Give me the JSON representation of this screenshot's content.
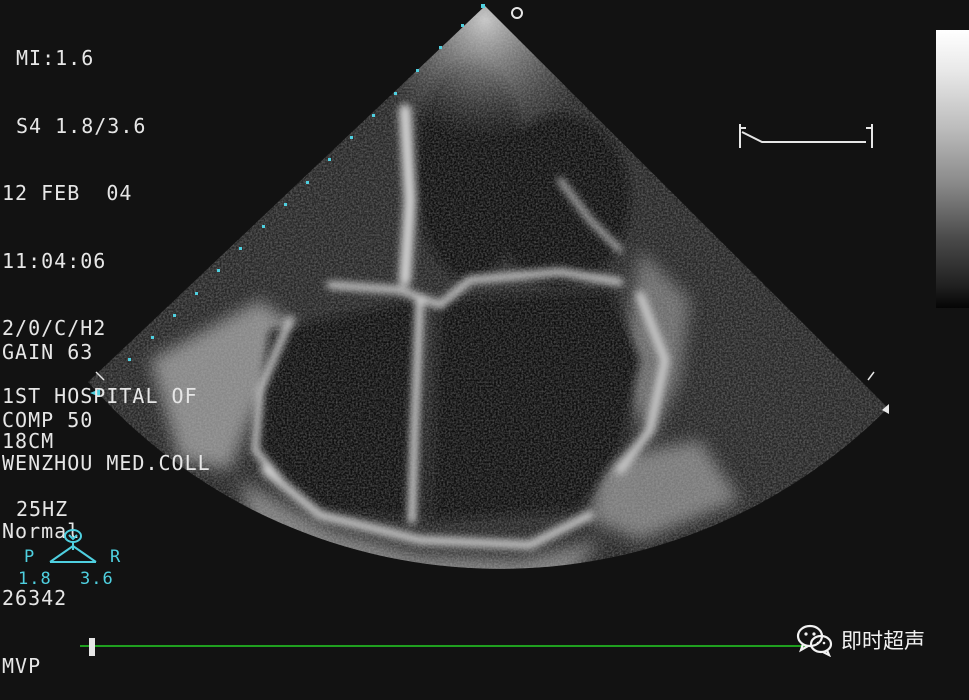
{
  "info_lines": {
    "mi": "MI:1.6",
    "probe": "S4 1.8/3.6",
    "date": "12 FEB  04",
    "time": "11:04:06",
    "mode": "2/0/C/H2",
    "hospital_1": "1ST HOSPITAL OF",
    "hospital_2": "WENZHOU MED.COLL",
    "patient_status": "Normal",
    "patient_id": "26342",
    "diagnosis": "MVP"
  },
  "settings": {
    "gain": "GAIN 63",
    "comp": "COMP 50"
  },
  "depth": {
    "depth": "18CM",
    "frame_rate": "25HZ"
  },
  "probe_orientation": {
    "left_label": "P",
    "right_label": "R",
    "left_value": "1.8",
    "right_value": "3.6"
  },
  "watermark": {
    "icon": "wechat-icon",
    "text": "即时超声"
  },
  "colors": {
    "background": "#121212",
    "overlay_text": "#e6e6e6",
    "cyan_marker": "#4fd0e0",
    "timeline": "#1fa01f"
  }
}
